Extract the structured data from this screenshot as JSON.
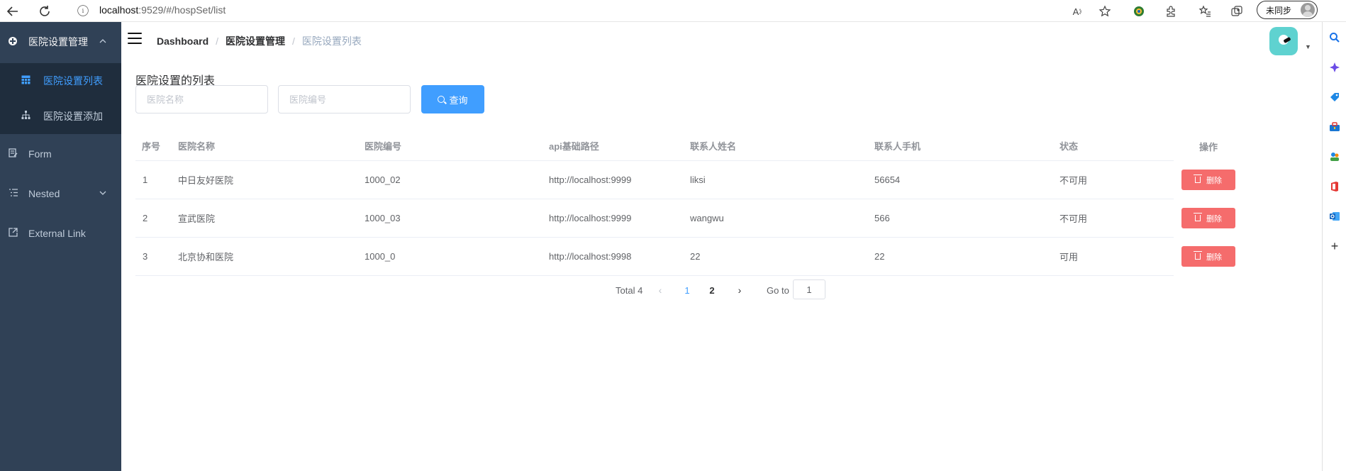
{
  "browser": {
    "back_icon": "back-arrow-icon",
    "refresh_icon": "refresh-icon",
    "info_icon": "info-icon",
    "url_host": "localhost",
    "url_path": ":9529/#/hospSet/list",
    "sync_label": "未同步",
    "read_aloud_glyph": "A",
    "toolbar_icons": [
      "read-aloud-icon",
      "add-favorite-icon",
      "extension-globe-icon",
      "extensions-icon",
      "favorites-icon",
      "collections-icon",
      "profile-avatar-icon"
    ]
  },
  "edge_sidebar": {
    "icons": [
      "search-icon",
      "copilot-icon",
      "shopping-tag-icon",
      "tools-icon",
      "games-icon",
      "office-icon",
      "outlook-icon",
      "add-icon"
    ]
  },
  "sidebar": {
    "items": [
      {
        "label": "医院设置管理",
        "icon": "settings-gear-icon",
        "expanded": true
      },
      {
        "label": "医院设置列表",
        "icon": "table-icon",
        "active": true
      },
      {
        "label": "医院设置添加",
        "icon": "tree-icon"
      },
      {
        "label": "Form",
        "icon": "form-icon"
      },
      {
        "label": "Nested",
        "icon": "nested-list-icon"
      },
      {
        "label": "External Link",
        "icon": "external-link-icon"
      }
    ]
  },
  "navbar": {
    "breadcrumb": [
      "Dashboard",
      "医院设置管理",
      "医院设置列表"
    ],
    "avatar_icon": "user-avatar-icon"
  },
  "main": {
    "title": "医院设置的列表",
    "search": {
      "name_placeholder": "医院名称",
      "code_placeholder": "医院编号",
      "name_value": "",
      "code_value": "",
      "button_label": "查询"
    },
    "table": {
      "columns": [
        "序号",
        "医院名称",
        "医院编号",
        "api基础路径",
        "联系人姓名",
        "联系人手机",
        "状态",
        "操作"
      ],
      "rows": [
        {
          "index": "1",
          "name": "中日友好医院",
          "code": "1000_02",
          "api": "http://localhost:9999",
          "contact": "liksi",
          "phone": "56654",
          "status": "不可用",
          "action": "删除"
        },
        {
          "index": "2",
          "name": "宣武医院",
          "code": "1000_03",
          "api": "http://localhost:9999",
          "contact": "wangwu",
          "phone": "566",
          "status": "不可用",
          "action": "删除"
        },
        {
          "index": "3",
          "name": "北京协和医院",
          "code": "1000_0",
          "api": "http://localhost:9998",
          "contact": "22",
          "phone": "22",
          "status": "可用",
          "action": "删除"
        }
      ]
    },
    "pagination": {
      "total_label": "Total 4",
      "pages": [
        "1",
        "2"
      ],
      "current_page": "1",
      "goto_label": "Go to",
      "goto_value": "1"
    }
  },
  "colors": {
    "sidebar_bg": "#304156",
    "submenu_bg": "#1f2d3d",
    "primary": "#409eff",
    "danger": "#f56c6c"
  }
}
